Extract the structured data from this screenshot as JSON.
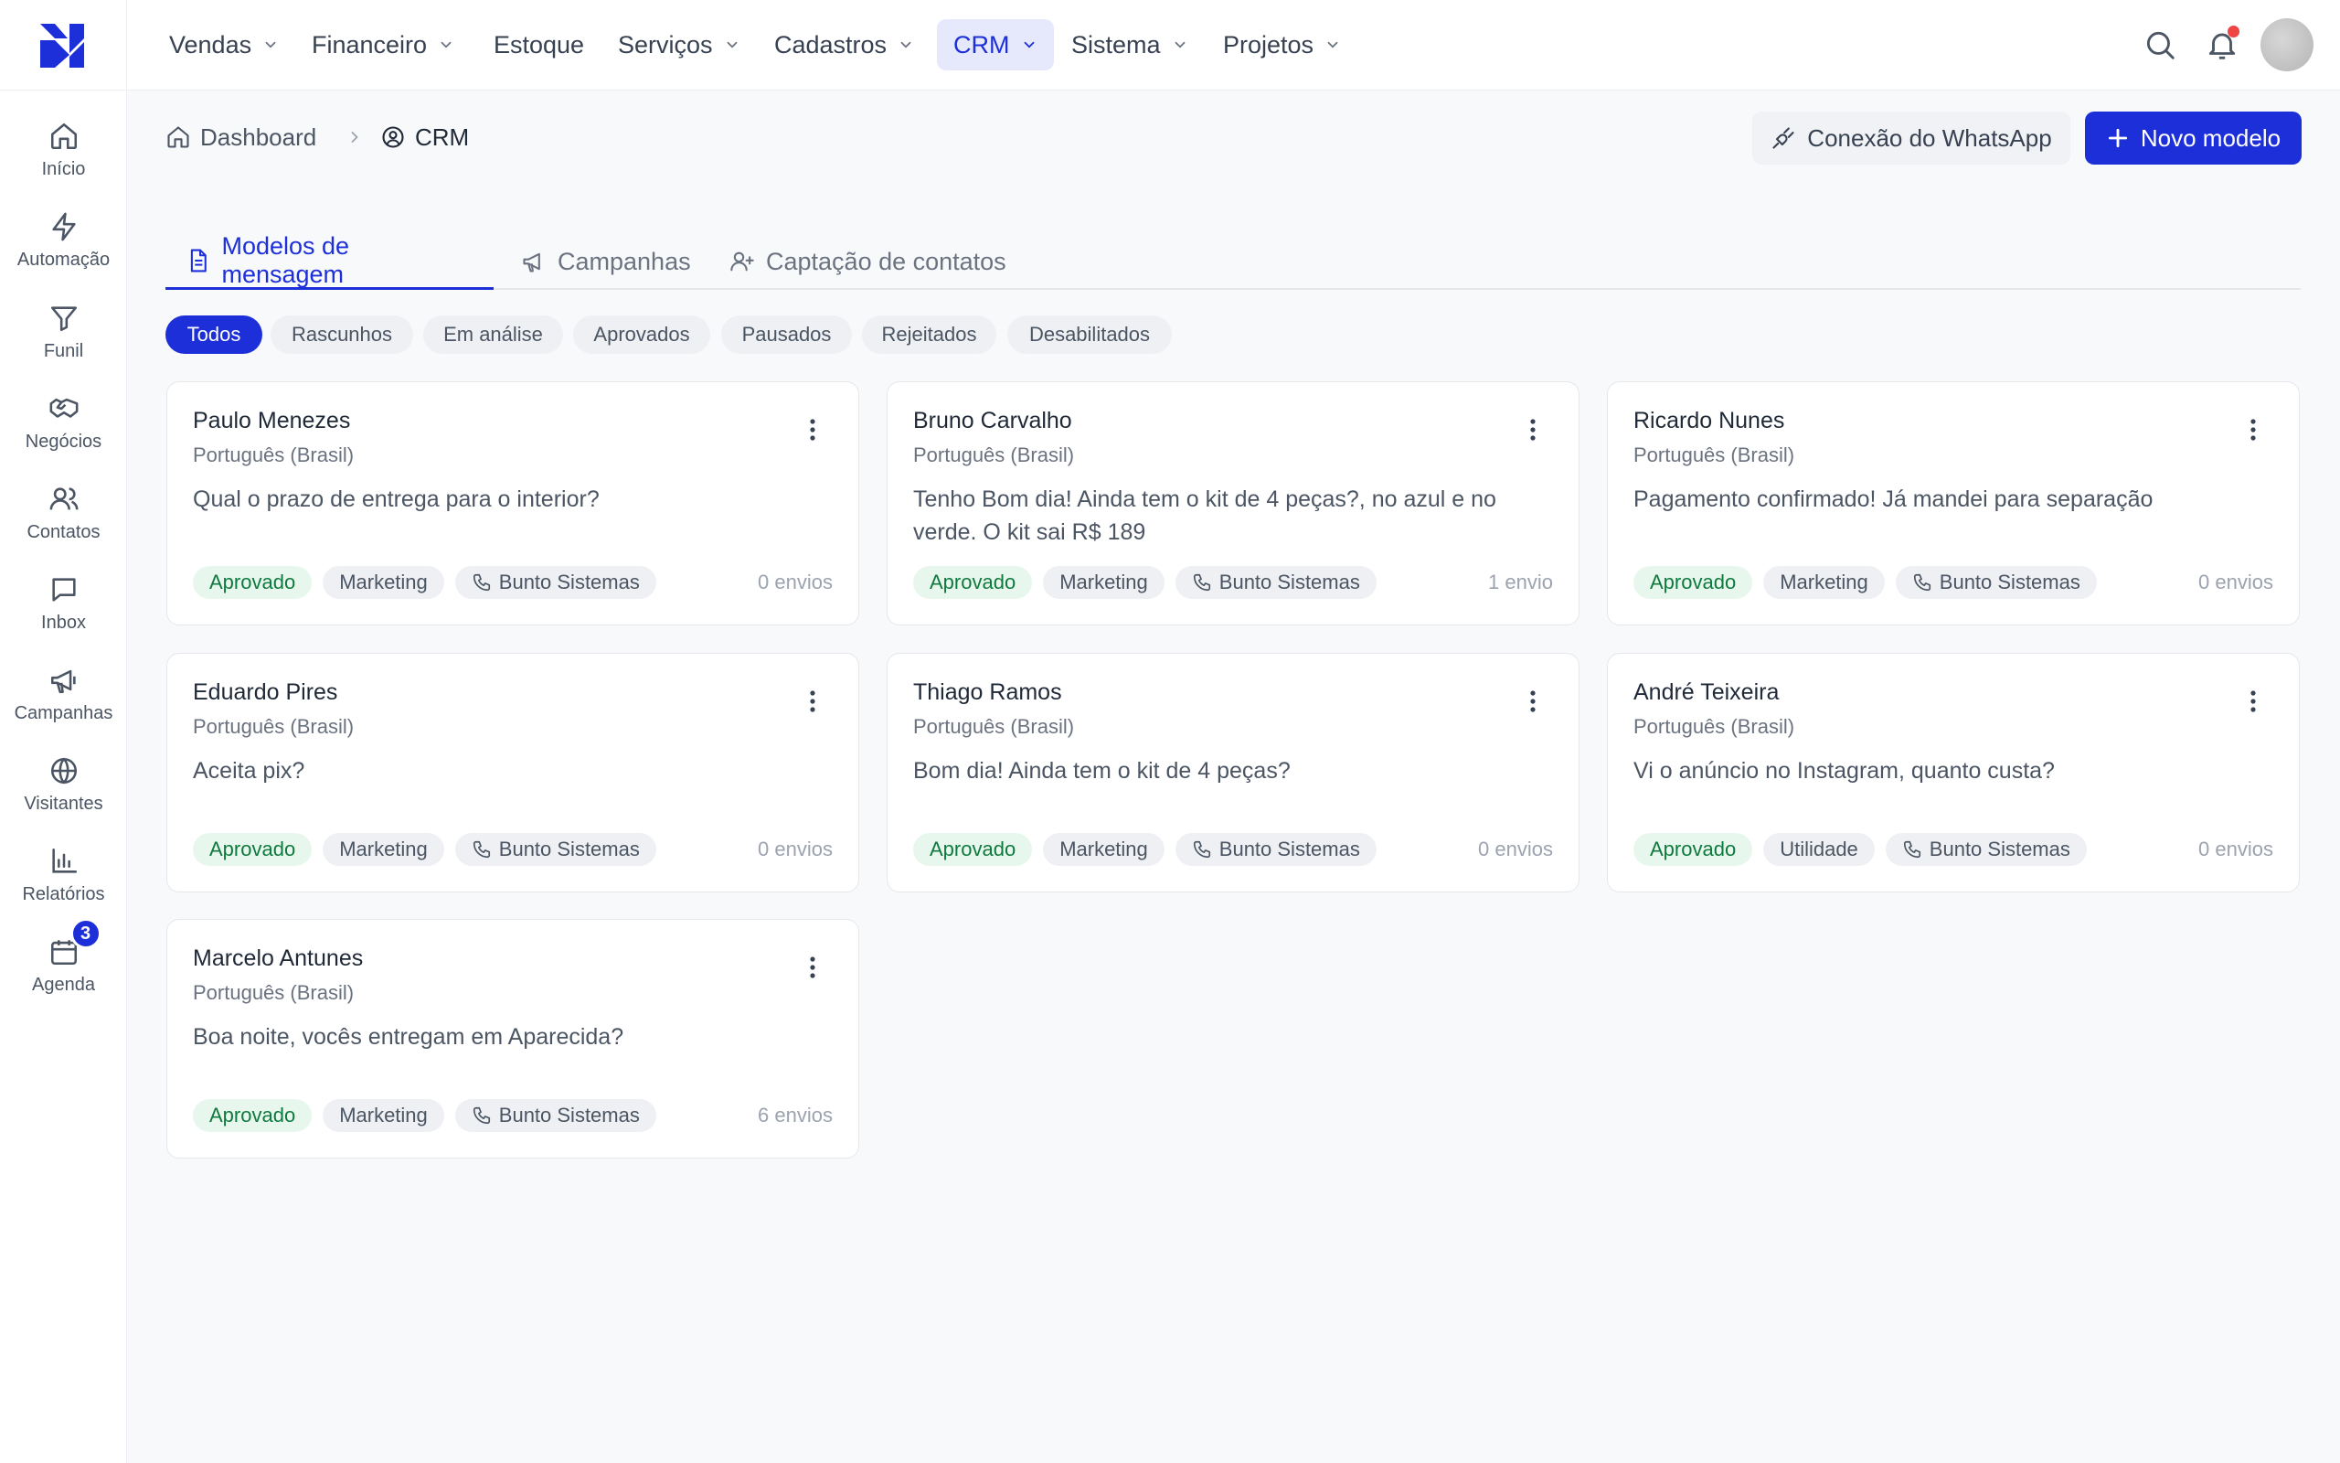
{
  "sidebar": {
    "items": [
      {
        "label": "Início",
        "icon": "home-icon"
      },
      {
        "label": "Automação",
        "icon": "bolt-icon"
      },
      {
        "label": "Funil",
        "icon": "filter-icon"
      },
      {
        "label": "Negócios",
        "icon": "handshake-icon"
      },
      {
        "label": "Contatos",
        "icon": "users-icon"
      },
      {
        "label": "Inbox",
        "icon": "chat-icon"
      },
      {
        "label": "Campanhas",
        "icon": "megaphone-icon"
      },
      {
        "label": "Visitantes",
        "icon": "globe-icon"
      },
      {
        "label": "Relatórios",
        "icon": "bar-chart-icon"
      },
      {
        "label": "Agenda",
        "icon": "calendar-icon",
        "badge": "3"
      }
    ]
  },
  "topnav": {
    "items": [
      {
        "label": "Vendas",
        "has_menu": true
      },
      {
        "label": "Financeiro",
        "has_menu": true
      },
      {
        "label": "Estoque",
        "has_menu": false
      },
      {
        "label": "Serviços",
        "has_menu": true
      },
      {
        "label": "Cadastros",
        "has_menu": true
      },
      {
        "label": "CRM",
        "has_menu": true,
        "active": true
      },
      {
        "label": "Sistema",
        "has_menu": true
      },
      {
        "label": "Projetos",
        "has_menu": true
      }
    ]
  },
  "breadcrumb": {
    "home": "Dashboard",
    "current": "CRM"
  },
  "actions": {
    "whatsapp": "Conexão do WhatsApp",
    "new_model": "Novo modelo"
  },
  "tabs": [
    {
      "label": "Modelos de mensagem",
      "icon": "document-icon",
      "active": true
    },
    {
      "label": "Campanhas",
      "icon": "megaphone-icon"
    },
    {
      "label": "Captação de contatos",
      "icon": "user-plus-icon"
    }
  ],
  "filters": [
    {
      "label": "Todos",
      "active": true
    },
    {
      "label": "Rascunhos"
    },
    {
      "label": "Em análise"
    },
    {
      "label": "Aprovados"
    },
    {
      "label": "Pausados"
    },
    {
      "label": "Rejeitados"
    },
    {
      "label": "Desabilitados"
    }
  ],
  "cards": [
    {
      "name": "Paulo Menezes",
      "lang": "Português (Brasil)",
      "message": "Qual o prazo de entrega para o interior?",
      "status": "Aprovado",
      "category": "Marketing",
      "phone": "Bunto Sistemas",
      "sends": "0 envios"
    },
    {
      "name": "Bruno Carvalho",
      "lang": "Português (Brasil)",
      "message": "Tenho Bom dia! Ainda tem o kit de 4 peças?, no azul e no verde. O kit sai R$ 189",
      "status": "Aprovado",
      "category": "Marketing",
      "phone": "Bunto Sistemas",
      "sends": "1 envio"
    },
    {
      "name": "Ricardo Nunes",
      "lang": "Português (Brasil)",
      "message": "Pagamento confirmado! Já mandei para separação",
      "status": "Aprovado",
      "category": "Marketing",
      "phone": "Bunto Sistemas",
      "sends": "0 envios"
    },
    {
      "name": "Eduardo Pires",
      "lang": "Português (Brasil)",
      "message": "Aceita pix?",
      "status": "Aprovado",
      "category": "Marketing",
      "phone": "Bunto Sistemas",
      "sends": "0 envios"
    },
    {
      "name": "Thiago Ramos",
      "lang": "Português (Brasil)",
      "message": "Bom dia! Ainda tem o kit de 4 peças?",
      "status": "Aprovado",
      "category": "Marketing",
      "phone": "Bunto Sistemas",
      "sends": "0 envios"
    },
    {
      "name": "André Teixeira",
      "lang": "Português (Brasil)",
      "message": "Vi o anúncio no Instagram, quanto custa?",
      "status": "Aprovado",
      "category": "Utilidade",
      "phone": "Bunto Sistemas",
      "sends": "0 envios"
    },
    {
      "name": "Marcelo Antunes",
      "lang": "Português (Brasil)",
      "message": "Boa noite, vocês entregam em Aparecida?",
      "status": "Aprovado",
      "category": "Marketing",
      "phone": "Bunto Sistemas",
      "sends": "6 envios"
    }
  ],
  "colors": {
    "accent": "#1d2fd8",
    "approved_bg": "#e8f7ee",
    "approved_text": "#0f7a3d",
    "notification": "#ef4444"
  }
}
